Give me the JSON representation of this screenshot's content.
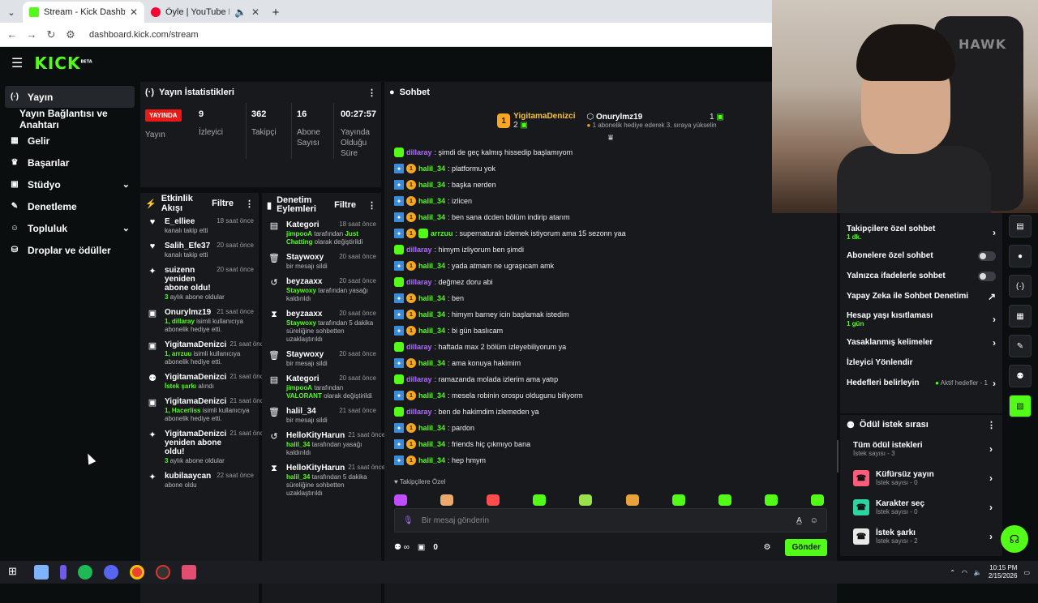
{
  "browser": {
    "tabs": [
      {
        "title": "Stream - Kick Dashboard",
        "favicon_color": "#53fc18"
      },
      {
        "title": "Öyle | YouTube Music",
        "favicon_color": "#ff0033"
      }
    ],
    "url": "dashboard.kick.com/stream"
  },
  "app": {
    "logo": "KICK",
    "logo_sup": "BETA"
  },
  "nav": [
    {
      "label": "Yayın",
      "icon": "broadcast-icon",
      "glyph": "(·)"
    },
    {
      "label": "Yayın Bağlantısı ve Anahtarı",
      "icon": "",
      "glyph": ""
    },
    {
      "label": "Gelir",
      "icon": "revenue-icon",
      "glyph": "▦"
    },
    {
      "label": "Başarılar",
      "icon": "trophy-icon",
      "glyph": "♛"
    },
    {
      "label": "Stüdyo",
      "icon": "studio-icon",
      "glyph": "▣",
      "chev": "⌄"
    },
    {
      "label": "Denetleme",
      "icon": "wrench-icon",
      "glyph": "✎"
    },
    {
      "label": "Topluluk",
      "icon": "community-icon",
      "glyph": "☺",
      "chev": "⌄"
    },
    {
      "label": "Droplar ve ödüller",
      "icon": "drops-icon",
      "glyph": "⛁"
    }
  ],
  "stats": {
    "title": "Yayın İstatistikleri",
    "live_badge": "YAYINDA",
    "items": [
      {
        "value": "",
        "label": "Yayın"
      },
      {
        "value": "9",
        "label": "İzleyici"
      },
      {
        "value": "362",
        "label": "Takipçi"
      },
      {
        "value": "16",
        "label": "Abone Sayısı"
      },
      {
        "value": "00:27:57",
        "label": "Yayında Olduğu Süre"
      }
    ]
  },
  "activity": {
    "title": "Etkinlik Akışı",
    "filter": "Filtre",
    "items": [
      {
        "icon": "♥",
        "name": "E_elliee",
        "time": "18 saat önce",
        "sub": "kanalı takip etti"
      },
      {
        "icon": "♥",
        "name": "Salih_Efe37",
        "time": "20 saat önce",
        "sub": "kanalı takip etti"
      },
      {
        "icon": "✦",
        "name": "suizenn yeniden abone oldu!",
        "time": "20 saat önce",
        "sub_g": "3",
        "sub": " aylık abone oldular"
      },
      {
        "icon": "▣",
        "name": "Onurylmz19",
        "time": "21 saat önce",
        "sub_g": "1, dillaray",
        "sub": " isimli kullanıcıya abonelik hediye etti."
      },
      {
        "icon": "▣",
        "name": "YigitamaDenizci",
        "time": "21 saat önce",
        "sub_g": "1, arrzuu",
        "sub": " isimli kullanıcıya abonelik hediye etti."
      },
      {
        "icon": "⚉",
        "name": "YigitamaDenizci",
        "time": "21 saat önce",
        "sub_g": "İstek şarkı",
        "sub": " alındı"
      },
      {
        "icon": "▣",
        "name": "YigitamaDenizci",
        "time": "21 saat önce",
        "sub_g": "1, Hacerliss",
        "sub": " isimli kullanıcıya abonelik hediye etti."
      },
      {
        "icon": "✦",
        "name": "YigitamaDenizci yeniden abone oldu!",
        "time": "21 saat önce",
        "sub_g": "3",
        "sub": " aylık abone oldular"
      },
      {
        "icon": "✦",
        "name": "kubilaaycan",
        "time": "22 saat önce",
        "sub": "abone oldu"
      }
    ]
  },
  "moderation": {
    "title": "Denetim Eylemleri",
    "filter": "Filtre",
    "items": [
      {
        "icon": "▤",
        "name": "Kategori",
        "time": "18 saat önce",
        "sub_g": "jimpooA",
        "sub": " tarafından ",
        "sub_g2": "Just Chatting",
        "sub2": " olarak değiştirildi"
      },
      {
        "icon": "🗑",
        "name": "Staywoxy",
        "time": "20 saat önce",
        "sub": "bir mesajı sildi"
      },
      {
        "icon": "↺",
        "name": "beyzaaxx",
        "time": "20 saat önce",
        "sub_g": "Staywoxy",
        "sub": " tarafından yasağı kaldırıldı"
      },
      {
        "icon": "⧗",
        "name": "beyzaaxx",
        "time": "20 saat önce",
        "sub_g": "Staywoxy",
        "sub": " tarafından 5 dakika süreliğine sohbetten uzaklaştırıldı"
      },
      {
        "icon": "🗑",
        "name": "Staywoxy",
        "time": "20 saat önce",
        "sub": "bir mesajı sildi"
      },
      {
        "icon": "▤",
        "name": "Kategori",
        "time": "20 saat önce",
        "sub_g": "jimpooA",
        "sub": " tarafından ",
        "sub_g2": "VALORANT",
        "sub2": " olarak değiştirildi"
      },
      {
        "icon": "🗑",
        "name": "halil_34",
        "time": "21 saat önce",
        "sub": "bir mesajı sildi"
      },
      {
        "icon": "↺",
        "name": "HelloKityHarun",
        "time": "21 saat önce",
        "sub_g": "halil_34",
        "sub": " tarafından yasağı kaldırıldı"
      },
      {
        "icon": "⧗",
        "name": "HelloKityHarun",
        "time": "21 saat önce",
        "sub_g": "halil_34",
        "sub": " tarafından 5 dakika süreliğine sohbetten uzaklaştırıldı"
      }
    ]
  },
  "chat": {
    "title": "Sohbet",
    "pinned_left_name": "YigitamaDenizci",
    "pinned_left_count": "2",
    "pinned_coin": "1",
    "pinned_right_name": "Onurylmz19",
    "pinned_right_count": "1",
    "pinned_right_sub": "1 abonelik hediye ederek 3. sıraya yükselin",
    "messages": [
      {
        "user": "dillaray",
        "color": "purple",
        "badges": [
          "s"
        ],
        "text": ": şimdi de geç kalmış hissedip başlamıyom"
      },
      {
        "user": "halil_34",
        "color": "green",
        "badges": [
          "v",
          "c"
        ],
        "text": ": platformu yok"
      },
      {
        "user": "halil_34",
        "color": "green",
        "badges": [
          "v",
          "c"
        ],
        "text": ": başka nerden"
      },
      {
        "user": "halil_34",
        "color": "green",
        "badges": [
          "v",
          "c"
        ],
        "text": ": izlicen"
      },
      {
        "user": "halil_34",
        "color": "green",
        "badges": [
          "v",
          "c"
        ],
        "text": ": ben sana dcden bölüm indirip atarım"
      },
      {
        "user": "arrzuu",
        "color": "green",
        "badges": [
          "v",
          "c",
          "s"
        ],
        "text": ": supernaturalı izlemek istiyorum ama 15 sezonn yaa"
      },
      {
        "user": "dillaray",
        "color": "purple",
        "badges": [
          "s"
        ],
        "text": ": himym izliyorum ben şimdi"
      },
      {
        "user": "halil_34",
        "color": "green",
        "badges": [
          "v",
          "c"
        ],
        "text": ": yada atmam ne ugraşıcam amk"
      },
      {
        "user": "dillaray",
        "color": "purple",
        "badges": [
          "s"
        ],
        "text": ": değmez doru abi"
      },
      {
        "user": "halil_34",
        "color": "green",
        "badges": [
          "v",
          "c"
        ],
        "text": ": ben"
      },
      {
        "user": "halil_34",
        "color": "green",
        "badges": [
          "v",
          "c"
        ],
        "text": ": himym barney icin başlamak istedim"
      },
      {
        "user": "halil_34",
        "color": "green",
        "badges": [
          "v",
          "c"
        ],
        "text": ": bi gün baslıcam"
      },
      {
        "user": "dillaray",
        "color": "purple",
        "badges": [
          "s"
        ],
        "text": ": haftada max 2 bölüm izleyebiliyorum ya"
      },
      {
        "user": "halil_34",
        "color": "green",
        "badges": [
          "v",
          "c"
        ],
        "text": ": ama konuya hakimim"
      },
      {
        "user": "dillaray",
        "color": "purple",
        "badges": [
          "s"
        ],
        "text": ": ramazanda molada izlerim ama yatıp"
      },
      {
        "user": "halil_34",
        "color": "green",
        "badges": [
          "v",
          "c"
        ],
        "text": ": mesela robinin orospu oldugunu biliyorm"
      },
      {
        "user": "dillaray",
        "color": "purple",
        "badges": [
          "s"
        ],
        "text": ": ben de hakimdim izlemeden ya"
      },
      {
        "user": "halil_34",
        "color": "green",
        "badges": [
          "v",
          "c"
        ],
        "text": ": pardon"
      },
      {
        "user": "halil_34",
        "color": "green",
        "badges": [
          "v",
          "c"
        ],
        "text": ": friends hiç çıkmıyo bana"
      },
      {
        "user": "halil_34",
        "color": "green",
        "badges": [
          "v",
          "c"
        ],
        "text": ": hep hmym"
      }
    ],
    "followers_tag": "Takipçilere Özel",
    "emote_colors": [
      "#c04dff",
      "#e9aa6b",
      "#ff4d4d",
      "#53fc18",
      "#9ae04d",
      "#e9a23b",
      "#53fc18",
      "#53fc18",
      "#53fc18",
      "#53fc18"
    ],
    "input_placeholder": "Bir mesaj gönderin",
    "count": "0",
    "send_label": "Gönder"
  },
  "chat_settings": {
    "items": [
      {
        "label": "Takipçilere özel sohbet",
        "sub": "1 dk.",
        "control": "chevron"
      },
      {
        "label": "Abonelere özel sohbet",
        "control": "toggle"
      },
      {
        "label": "Yalnızca ifadelerle sohbet",
        "control": "toggle"
      },
      {
        "label": "Yapay Zeka ile Sohbet Denetimi",
        "control": "external"
      },
      {
        "label": "Hesap yaşı kısıtlaması",
        "sub": "1 gün",
        "control": "chevron"
      },
      {
        "label": "Yasaklanmış kelimeler",
        "control": "chevron"
      },
      {
        "label": "İzleyici Yönlendir",
        "control": "none"
      },
      {
        "label": "Hedefleri belirleyin",
        "status": "Aktif hedefler - 1",
        "control": "chevron"
      }
    ]
  },
  "reward_queue": {
    "title": "Ödül istek sırası",
    "items": [
      {
        "label": "Tüm ödül istekleri",
        "sub": "İstek sayısı - 3",
        "color": ""
      },
      {
        "label": "Küfürsüz yayın",
        "sub": "İstek sayısı - 0",
        "color": "#ff5b7a"
      },
      {
        "label": "Karakter seç",
        "sub": "İstek sayısı - 0",
        "color": "#2bd4a0"
      },
      {
        "label": "İstek şarkı",
        "sub": "İstek sayısı - 2",
        "color": "#e8e8e8"
      }
    ]
  },
  "webcam": {
    "overlay_text": "HAWK"
  },
  "taskbar": {
    "time": "10:15 PM",
    "date": "2/15/2026"
  }
}
